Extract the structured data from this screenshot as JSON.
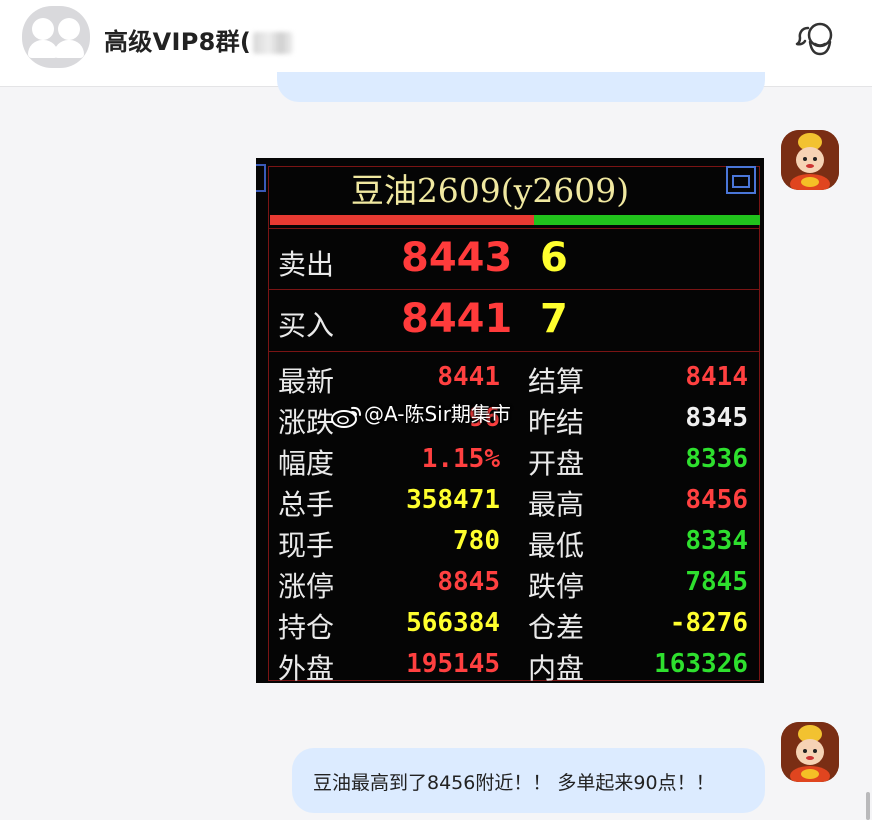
{
  "header": {
    "group_name": "高级VIP8群(",
    "profile_icon": "group-members-icon"
  },
  "image_message": {
    "title": "豆油2609(y2609)",
    "sell": {
      "label": "卖出",
      "price": "8443",
      "volume": "6"
    },
    "buy": {
      "label": "买入",
      "price": "8441",
      "volume": "7"
    },
    "stats": [
      {
        "left_label": "最新",
        "left_value": "8441",
        "left_color": "#ff4040",
        "right_label": "结算",
        "right_value": "8414",
        "right_color": "#ff4040"
      },
      {
        "left_label": "涨跌",
        "left_value": "96",
        "left_color": "#ff4040",
        "right_label": "昨结",
        "right_value": "8345",
        "right_color": "#f0f0f0"
      },
      {
        "left_label": "幅度",
        "left_value": "1.15%",
        "left_color": "#ff4040",
        "right_label": "开盘",
        "right_value": "8336",
        "right_color": "#2ee02e"
      },
      {
        "left_label": "总手",
        "left_value": "358471",
        "left_color": "#ffff2e",
        "right_label": "最高",
        "right_value": "8456",
        "right_color": "#ff4040"
      },
      {
        "left_label": "现手",
        "left_value": "780",
        "left_color": "#ffff2e",
        "right_label": "最低",
        "right_value": "8334",
        "right_color": "#2ee02e"
      },
      {
        "left_label": "涨停",
        "left_value": "8845",
        "left_color": "#ff4040",
        "right_label": "跌停",
        "right_value": "7845",
        "right_color": "#2ee02e"
      },
      {
        "left_label": "持仓",
        "left_value": "566384",
        "left_color": "#ffff2e",
        "right_label": "仓差",
        "right_value": "-8276",
        "right_color": "#ffff2e"
      },
      {
        "left_label": "外盘",
        "left_value": "195145",
        "left_color": "#ff4040",
        "right_label": "内盘",
        "right_value": "163326",
        "right_color": "#2ee02e"
      }
    ],
    "watermark": "@A-陈Sir期集市"
  },
  "text_message": "豆油最高到了8456附近！！ 多单起来90点！！",
  "colors": {
    "bubble": "#dcebff",
    "price_up": "#ff4040",
    "price_down": "#2ee02e",
    "volume": "#ffff2e"
  }
}
